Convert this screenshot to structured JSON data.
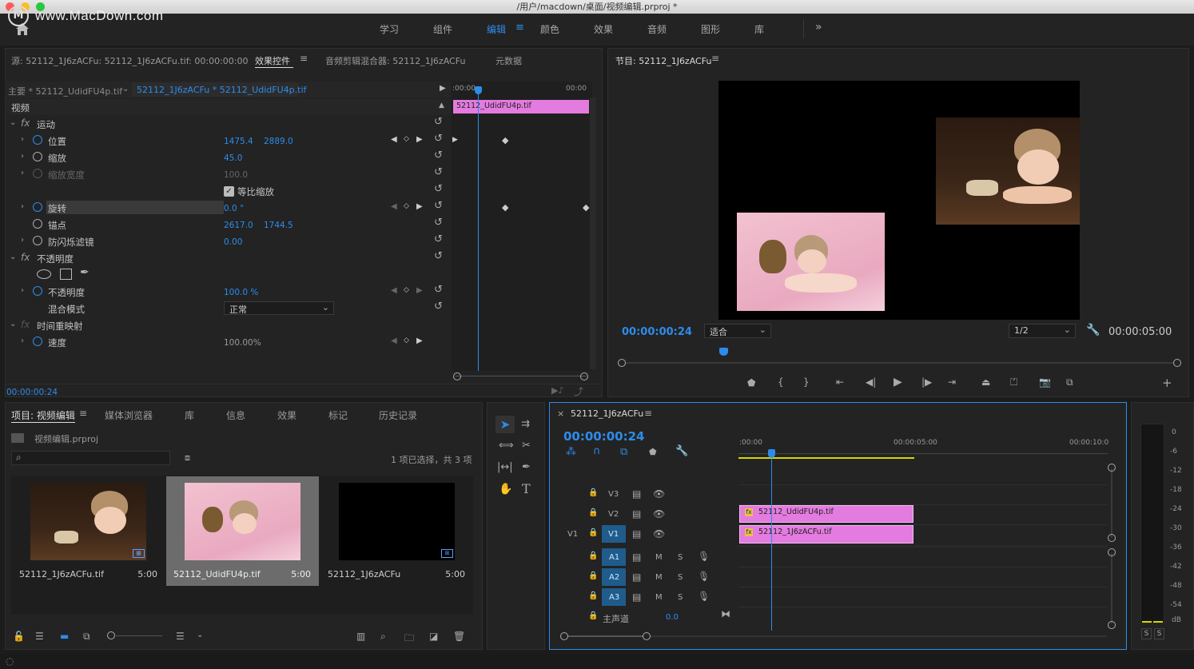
{
  "window": {
    "title": "/用户/macdown/桌面/视频编辑.prproj *"
  },
  "watermark": {
    "text": "www.MacDown.com",
    "logo": "M"
  },
  "workspaces": {
    "items": [
      {
        "label": "学习"
      },
      {
        "label": "组件"
      },
      {
        "label": "编辑"
      },
      {
        "label": "颜色"
      },
      {
        "label": "效果"
      },
      {
        "label": "音频"
      },
      {
        "label": "图形"
      },
      {
        "label": "库"
      }
    ],
    "active": "编辑",
    "more": "»"
  },
  "source_panel": {
    "tabs": [
      {
        "label": "源: 52112_1J6zACFu: 52112_1J6zACFu.tif: 00:00:00:00"
      },
      {
        "label": "效果控件"
      },
      {
        "label": "音频剪辑混合器: 52112_1J6zACFu"
      },
      {
        "label": "元数据"
      }
    ],
    "breadcrumb_main": "主要 * 52112_UdidFU4p.tif",
    "breadcrumb_seq": "52112_1J6zACFu * 52112_UdidFU4p.tif",
    "mini_timeline": {
      "start": ":00:00",
      "end": "00:00",
      "clip_label": "52112_UdidFU4p.tif"
    },
    "section_video": "视频",
    "motion": "运动",
    "position": {
      "label": "位置",
      "x": "1475.4",
      "y": "2889.0"
    },
    "scale": {
      "label": "缩放",
      "value": "45.0"
    },
    "scale_width": {
      "label": "缩放宽度",
      "value": "100.0"
    },
    "uniform_scale": "等比缩放",
    "rotation": {
      "label": "旋转",
      "value": "0.0 °"
    },
    "anchor": {
      "label": "锚点",
      "x": "2617.0",
      "y": "1744.5"
    },
    "antiflicker": {
      "label": "防闪烁滤镜",
      "value": "0.00"
    },
    "opacity_section": "不透明度",
    "opacity": {
      "label": "不透明度",
      "value": "100.0 %"
    },
    "blend": {
      "label": "混合模式",
      "value": "正常"
    },
    "time_remap": "时间重映射",
    "speed": {
      "label": "速度",
      "value": "100.00%"
    },
    "timecode": "00:00:00:24"
  },
  "program_monitor": {
    "title": "节目: 52112_1J6zACFu",
    "timecode": "00:00:00:24",
    "fit": "适合",
    "resolution": "1/2",
    "duration": "00:00:05:00"
  },
  "project_panel": {
    "tabs": [
      {
        "label": "项目: 视频编辑"
      },
      {
        "label": "媒体浏览器"
      },
      {
        "label": "库"
      },
      {
        "label": "信息"
      },
      {
        "label": "效果"
      },
      {
        "label": "标记"
      },
      {
        "label": "历史记录"
      }
    ],
    "file": "视频编辑.prproj",
    "search_placeholder": "",
    "selection_info": "1 项已选择，共 3 项",
    "items": [
      {
        "name": "52112_1J6zACFu.tif",
        "duration": "5:00"
      },
      {
        "name": "52112_UdidFU4p.tif",
        "duration": "5:00"
      },
      {
        "name": "52112_1J6zACFu",
        "duration": "5:00"
      }
    ]
  },
  "timeline": {
    "title": "52112_1J6zACFu",
    "timecode": "00:00:00:24",
    "ruler": {
      "t0": ":00:00",
      "t1": "00:00:05:00",
      "t2": "00:00:10:0"
    },
    "tracks": [
      {
        "id": "V3"
      },
      {
        "id": "V2"
      },
      {
        "id": "V1",
        "source": "V1"
      },
      {
        "id": "A1",
        "m": "M",
        "s": "S"
      },
      {
        "id": "A2",
        "m": "M",
        "s": "S"
      },
      {
        "id": "A3",
        "m": "M",
        "s": "S"
      }
    ],
    "master": {
      "label": "主声道",
      "value": "0.0"
    },
    "clips": [
      {
        "track": "V2",
        "label": "52112_UdidFU4p.tif"
      },
      {
        "track": "V1",
        "label": "52112_1J6zACFu.tif"
      }
    ]
  },
  "audio_meter": {
    "scale": [
      "0",
      "-6",
      "-12",
      "-18",
      "-24",
      "-30",
      "-36",
      "-42",
      "-48",
      "-54",
      "dB"
    ],
    "solo": [
      "S",
      "S"
    ]
  },
  "colors": {
    "accent": "#2d8ceb",
    "clip": "#e47be0",
    "playhead": "#2d8ceb"
  }
}
